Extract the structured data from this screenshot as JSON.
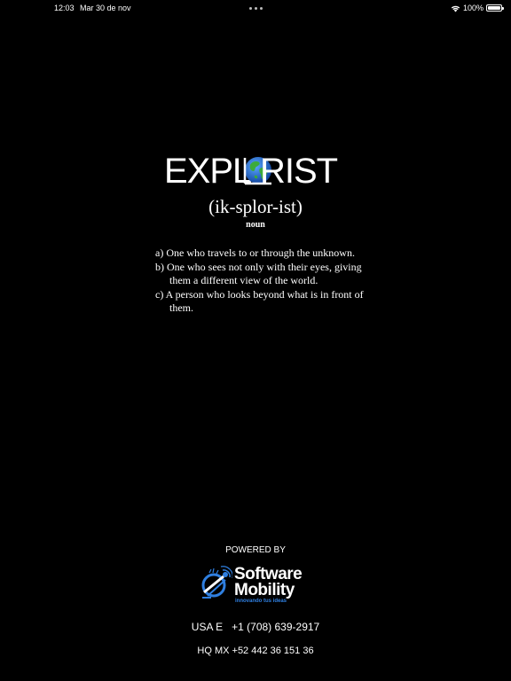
{
  "status_bar": {
    "time": "12:03",
    "date": "Mar 30 de nov",
    "battery_percent": "100%",
    "battery_level": 1.0
  },
  "logo": {
    "text_left": "EXPL",
    "text_right": "RIST"
  },
  "entry": {
    "pronunciation": "(ik-splor-ist)",
    "word_class": "noun",
    "definitions": [
      "a) One who travels to or through the unknown.",
      "b) One who sees not only with their eyes, giving them a different view of the world.",
      "c) A person who looks beyond what is in front of them."
    ]
  },
  "footer": {
    "powered_by": "POWERED BY",
    "brand_line1": "Software",
    "brand_line2": "Mobility",
    "brand_tagline": "innovando tus ideas",
    "phone_usa": "USA E   +1 (708) 639-2917",
    "phone_mx": "HQ MX +52 442 36 151 36"
  },
  "colors": {
    "background": "#000000",
    "text": "#ffffff",
    "brand_accent": "#2f7fe0",
    "globe_ocean": "#1f6fd0",
    "globe_land": "#3cab3a"
  }
}
